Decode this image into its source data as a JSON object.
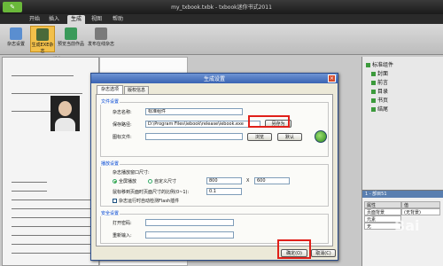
{
  "window": {
    "title": "my_txbook.txbk - txbook迷你书式2011"
  },
  "menu": [
    {
      "label": "开始",
      "active": false
    },
    {
      "label": "插入",
      "active": false
    },
    {
      "label": "生成",
      "active": true
    },
    {
      "label": "视图",
      "active": false
    },
    {
      "label": "帮助",
      "active": false
    }
  ],
  "ribbon": {
    "buttons": [
      {
        "label": "杂志设置",
        "icon": "magazine-settings-icon",
        "active": false
      },
      {
        "label": "生成EXE杂志",
        "icon": "generate-exe-icon",
        "active": true
      },
      {
        "label": "预览当前作品",
        "icon": "preview-icon",
        "active": false
      },
      {
        "label": "发布在线杂志",
        "icon": "publish-icon",
        "active": false
      }
    ],
    "group_label": "操作"
  },
  "tree": [
    "标准组件",
    "封面",
    "前言",
    "目录",
    "书页",
    "结尾"
  ],
  "props": {
    "title": "1 - 部目51",
    "headers": [
      "属性",
      "值"
    ],
    "rows": [
      [
        "页面背景",
        "(无背景)"
      ],
      [
        "元素",
        ""
      ],
      [
        "无",
        ""
      ]
    ]
  },
  "dialog": {
    "title": "生成设置",
    "tabs": [
      "杂志选项",
      "版权信息"
    ],
    "file_group": "文件设置",
    "magazine_name_label": "杂志名称:",
    "magazine_name_value": "标准组件",
    "save_path_label": "保存路径:",
    "save_path_value": "D:\\Program Files\\iebook\\release\\iebook.exe",
    "save_as_button": "另存为",
    "icon_file_label": "图标文件:",
    "browse_button": "浏览",
    "default_button": "默认",
    "display_group": "播放设置",
    "window_size_label": "杂志播放窗口尺寸:",
    "fullscreen_label": "全屏播放",
    "custom_size_label": "自定义尺寸",
    "width_value": "800",
    "height_value": "600",
    "times_symbol": "X",
    "zoom_label": "鼠标移到页面时页面尺寸的比例(0~1):",
    "zoom_value": "0.1",
    "fp_label": "杂志运行时自动检测Flash插件",
    "security_group": "安全设置",
    "password_label": "打开密码:",
    "repeat_label": "重新输入:",
    "ok_button": "确定(O)",
    "cancel_button": "取消(C)"
  },
  "watermark": "Bai"
}
